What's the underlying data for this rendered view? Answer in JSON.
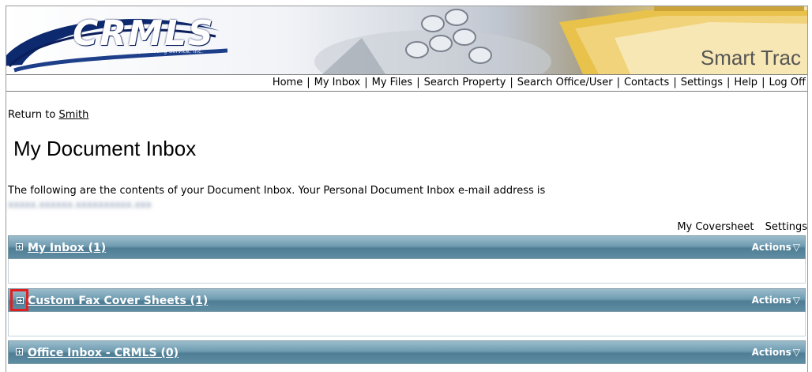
{
  "banner": {
    "logo_text": "CRMLS",
    "logo_subtitle": "California Regional Multiple Listing Service, Inc.",
    "product_name": "Smart Trac"
  },
  "nav": {
    "items": [
      "Home",
      "My Inbox",
      "My Files",
      "Search Property",
      "Search Office/User",
      "Contacts",
      "Settings",
      "Help",
      "Log Off"
    ],
    "separator": "|"
  },
  "return_link": {
    "prefix": "Return to",
    "link": "Smith"
  },
  "page_title": "My Document Inbox",
  "intro_text": "The following are the contents of your Document Inbox. Your Personal Document Inbox e-mail address is",
  "email_redacted": "xxxxx.xxxxxx.xxxxxxxxxx.xxx",
  "right_links": {
    "coversheet": "My Coversheet",
    "settings": "Settings"
  },
  "panels": [
    {
      "label": "My Inbox (1)",
      "actions": "Actions",
      "highlighted": false
    },
    {
      "label": "Custom Fax Cover Sheets (1)",
      "actions": "Actions",
      "highlighted": true
    },
    {
      "label": "Office Inbox - CRMLS (0)",
      "actions": "Actions",
      "highlighted": false
    }
  ],
  "colors": {
    "panel_header": "#5f8da3",
    "highlight": "#e02020",
    "link": "#000000"
  }
}
